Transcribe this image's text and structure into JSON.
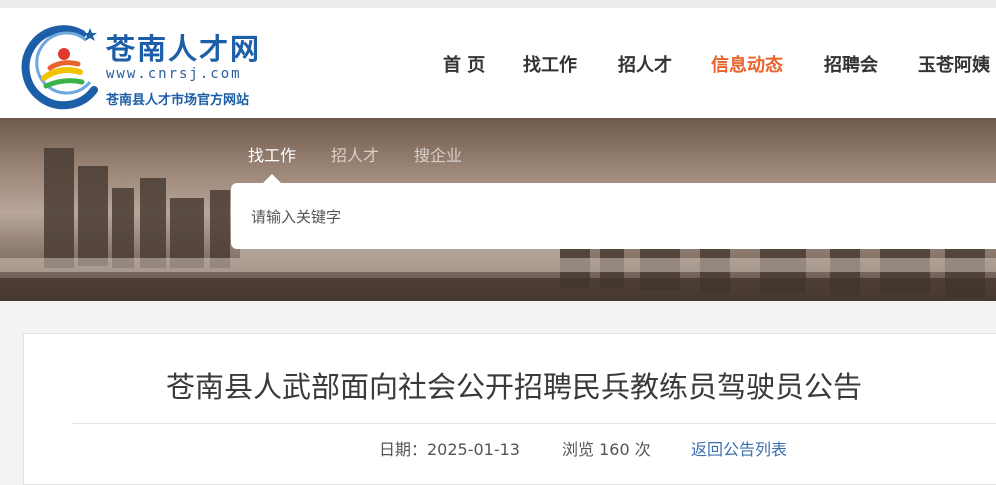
{
  "site": {
    "logo_title": "苍南人才网",
    "logo_url": "www.cnrsj.com",
    "logo_subtitle": "苍南县人才市场官方网站"
  },
  "nav": {
    "items": [
      {
        "label": "首 页"
      },
      {
        "label": "找工作"
      },
      {
        "label": "招人才"
      },
      {
        "label": "信息动态",
        "active": true
      },
      {
        "label": "招聘会"
      },
      {
        "label": "玉苍阿姨"
      }
    ]
  },
  "search": {
    "tabs": [
      {
        "label": "找工作",
        "active": true
      },
      {
        "label": "招人才"
      },
      {
        "label": "搜企业"
      }
    ],
    "placeholder": "请输入关键字"
  },
  "article": {
    "title": "苍南县人武部面向社会公开招聘民兵教练员驾驶员公告",
    "date_label": "日期：2025-01-13",
    "views_label": "浏览 160 次",
    "back_link": "返回公告列表"
  },
  "colors": {
    "brand_blue": "#1d5ea8",
    "nav_active": "#e8642c",
    "link": "#3a6fb0"
  }
}
